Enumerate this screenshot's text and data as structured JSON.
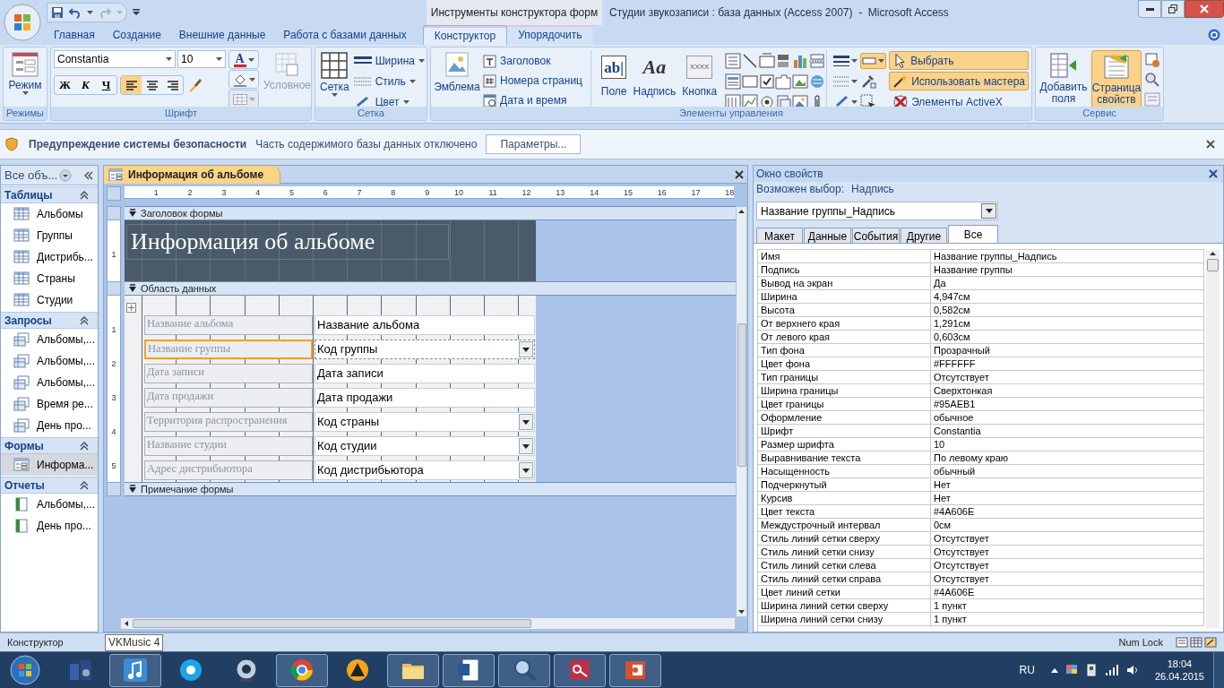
{
  "title_bar": {
    "contextual_label": "Инструменты конструктора форм",
    "title": "Студии звукозаписи : база данных (Access 2007)  -  Microsoft Access"
  },
  "ribbon_tabs": [
    {
      "label": "Главная",
      "selected": false,
      "contextual": false
    },
    {
      "label": "Создание",
      "selected": false,
      "contextual": false
    },
    {
      "label": "Внешние данные",
      "selected": false,
      "contextual": false
    },
    {
      "label": "Работа с базами данных",
      "selected": false,
      "contextual": false
    },
    {
      "label": "Конструктор",
      "selected": true,
      "contextual": true
    },
    {
      "label": "Упорядочить",
      "selected": false,
      "contextual": true
    }
  ],
  "ribbon": {
    "modes": {
      "label": "Режимы",
      "view_button": "Режим"
    },
    "font": {
      "label": "Шрифт",
      "font_name": "Constantia",
      "font_size": "10",
      "font_color_glyph": "A",
      "style_buttons": [
        "Ж",
        "К",
        "Ч"
      ],
      "align_buttons": [
        {
          "selected": true
        },
        {
          "selected": false
        },
        {
          "selected": false
        }
      ],
      "conditional": {
        "label": "Условное",
        "disabled": true
      }
    },
    "gridlines": {
      "label": "Сетка",
      "button": "Сетка",
      "items": [
        "Ширина",
        "Стиль",
        "Цвет"
      ]
    },
    "controls": {
      "label": "Элементы управления",
      "logo_button": "Эмблема",
      "header_items": [
        "Заголовок",
        "Номера страниц",
        "Дата и время"
      ],
      "big_tools": [
        {
          "label": "Поле",
          "glyph": "ab|"
        },
        {
          "label": "Надпись",
          "glyph": "Aa"
        },
        {
          "label": "Кнопка",
          "glyph": "XXXX"
        }
      ],
      "toggles": [
        {
          "label": "Выбрать",
          "selected": true
        },
        {
          "label": "Использовать мастера",
          "selected": true
        },
        {
          "label": "Элементы ActiveX",
          "selected": false
        }
      ]
    },
    "tools": {
      "label": "Сервис",
      "buttons": [
        {
          "label": "Добавить поля",
          "selected": false
        },
        {
          "label": "Страница свойств",
          "selected": true
        }
      ]
    }
  },
  "security_bar": {
    "title": "Предупреждение системы безопасности",
    "message": "Часть содержимого базы данных отключено",
    "button": "Параметры..."
  },
  "nav_pane": {
    "header": "Все объ...",
    "groups": [
      {
        "kind": "tables",
        "label": "Таблицы",
        "items": [
          {
            "label": "Альбомы",
            "selected": false
          },
          {
            "label": "Группы",
            "selected": false
          },
          {
            "label": "Дистрибь...",
            "selected": false
          },
          {
            "label": "Страны",
            "selected": false
          },
          {
            "label": "Студии",
            "selected": false
          }
        ]
      },
      {
        "kind": "queries",
        "label": "Запросы",
        "items": [
          {
            "label": "Альбомы,...",
            "selected": false
          },
          {
            "label": "Альбомы,...",
            "selected": false
          },
          {
            "label": "Альбомы,...",
            "selected": false
          },
          {
            "label": "Время ре...",
            "selected": false
          },
          {
            "label": "День про...",
            "selected": false
          }
        ]
      },
      {
        "kind": "forms",
        "label": "Формы",
        "items": [
          {
            "label": "Информа...",
            "selected": true
          }
        ]
      },
      {
        "kind": "reports",
        "label": "Отчеты",
        "items": [
          {
            "label": "Альбомы,...",
            "selected": false
          },
          {
            "label": "День про...",
            "selected": false
          }
        ]
      }
    ]
  },
  "document": {
    "tab": "Информация об альбоме",
    "ruler_marks": [
      "1",
      "2",
      "3",
      "4",
      "5",
      "6",
      "7",
      "8",
      "9",
      "10",
      "11",
      "12",
      "13",
      "14",
      "15",
      "16",
      "17",
      "18"
    ],
    "sections": [
      {
        "kind": "header",
        "label": "Заголовок формы",
        "title": "Информация об альбоме",
        "ruler_marks": [
          "1"
        ]
      },
      {
        "kind": "detail",
        "label": "Область данных",
        "ruler_marks": [
          "1",
          "2",
          "3",
          "4",
          "5"
        ],
        "fields": [
          {
            "label": "Название альбома",
            "control": "Название альбома",
            "kind": "textbox",
            "selected": false
          },
          {
            "label": "Название группы",
            "control": "Код группы",
            "kind": "combobox",
            "selected": true
          },
          {
            "label": "Дата записи",
            "control": "Дата записи",
            "kind": "textbox",
            "selected": false
          },
          {
            "label": "Дата продажи",
            "control": "Дата продажи",
            "kind": "textbox",
            "selected": false
          },
          {
            "label": "Территория распространения",
            "control": "Код страны",
            "kind": "combobox",
            "selected": false
          },
          {
            "label": "Название студии",
            "control": "Код студии",
            "kind": "combobox",
            "selected": false
          },
          {
            "label": "Адрес дистрибьютора",
            "control": "Код дистрибьютора",
            "kind": "combobox",
            "selected": false
          }
        ]
      },
      {
        "kind": "footer",
        "label": "Примечание формы"
      }
    ]
  },
  "properties": {
    "title": "Окно свойств",
    "selection_type_label": "Возможен выбор:",
    "selection_type": "Надпись",
    "object": "Название группы_Надпись",
    "tabs": [
      {
        "label": "Макет",
        "selected": false
      },
      {
        "label": "Данные",
        "selected": false
      },
      {
        "label": "События",
        "selected": false
      },
      {
        "label": "Другие",
        "selected": false
      },
      {
        "label": "Все",
        "selected": true
      }
    ],
    "rows": [
      {
        "name": "Имя",
        "value": "Название группы_Надпись"
      },
      {
        "name": "Подпись",
        "value": "Название группы"
      },
      {
        "name": "Вывод на экран",
        "value": "Да"
      },
      {
        "name": "Ширина",
        "value": "4,947см"
      },
      {
        "name": "Высота",
        "value": "0,582см"
      },
      {
        "name": "От верхнего края",
        "value": "1,291см"
      },
      {
        "name": "От левого края",
        "value": "0,603см"
      },
      {
        "name": "Тип фона",
        "value": "Прозрачный"
      },
      {
        "name": "Цвет фона",
        "value": "#FFFFFF"
      },
      {
        "name": "Тип границы",
        "value": "Отсутствует"
      },
      {
        "name": "Ширина границы",
        "value": "Сверхтонкая"
      },
      {
        "name": "Цвет границы",
        "value": "#95AEB1"
      },
      {
        "name": "Оформление",
        "value": "обычное"
      },
      {
        "name": "Шрифт",
        "value": "Constantia"
      },
      {
        "name": "Размер шрифта",
        "value": "10"
      },
      {
        "name": "Выравнивание текста",
        "value": "По левому краю"
      },
      {
        "name": "Насыщенность",
        "value": "обычный"
      },
      {
        "name": "Подчеркнутый",
        "value": "Нет"
      },
      {
        "name": "Курсив",
        "value": "Нет"
      },
      {
        "name": "Цвет текста",
        "value": "#4A606E"
      },
      {
        "name": "Междустрочный интервал",
        "value": "0см"
      },
      {
        "name": "Стиль линий сетки сверху",
        "value": "Отсутствует"
      },
      {
        "name": "Стиль линий сетки снизу",
        "value": "Отсутствует"
      },
      {
        "name": "Стиль линий сетки слева",
        "value": "Отсутствует"
      },
      {
        "name": "Стиль линий сетки справа",
        "value": "Отсутствует"
      },
      {
        "name": "Цвет линий сетки",
        "value": "#4A606E"
      },
      {
        "name": "Ширина линий сетки сверху",
        "value": "1 пункт"
      },
      {
        "name": "Ширина линий сетки снизу",
        "value": "1 пункт"
      }
    ]
  },
  "status_bar": {
    "mode": "Конструктор",
    "indicator": "Num Lock"
  },
  "tooltip": "VKMusic 4",
  "taskbar": {
    "apps": [
      {
        "kind": "speakers",
        "open": false
      },
      {
        "kind": "note",
        "open": true
      },
      {
        "kind": "phone",
        "open": false
      },
      {
        "kind": "webcam",
        "open": false
      },
      {
        "kind": "ring",
        "open": true
      },
      {
        "kind": "triangle",
        "open": false
      },
      {
        "kind": "folder",
        "open": true
      },
      {
        "kind": "document",
        "open": true
      },
      {
        "kind": "magnifier",
        "open": true
      },
      {
        "kind": "key",
        "open": true
      },
      {
        "kind": "slide",
        "open": true
      }
    ],
    "tray": {
      "language": "RU",
      "time": "18:04",
      "date": "26.04.2015"
    }
  }
}
